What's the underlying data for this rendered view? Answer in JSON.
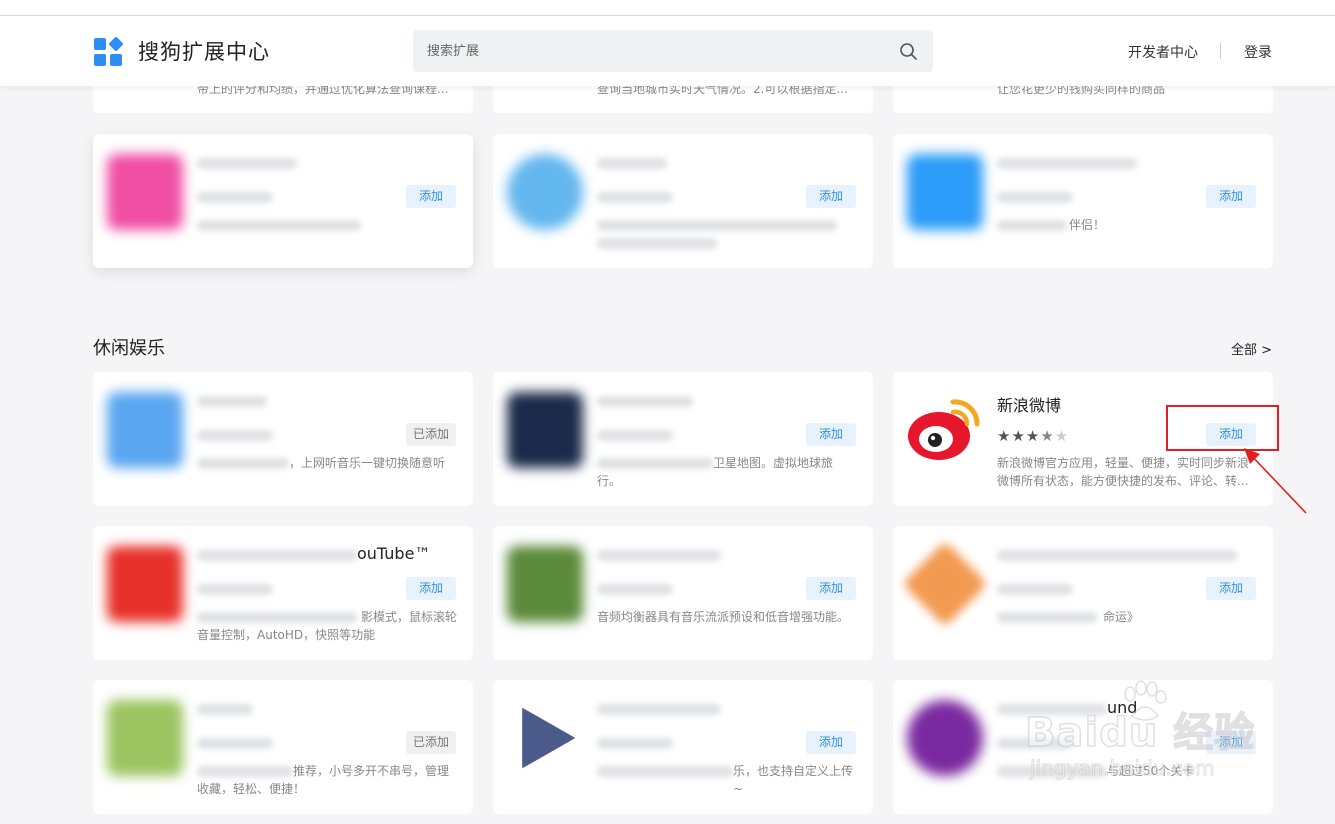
{
  "header": {
    "logo_text": "搜狗扩展中心",
    "search_placeholder": "搜索扩展",
    "developer_center": "开发者中心",
    "login": "登录"
  },
  "top_cut_row": [
    {
      "desc": "帝上的评分和均绩，并通过优化算法查询课程..."
    },
    {
      "desc": "查询当地城市实时天气情况。2.可以根据指定..."
    },
    {
      "desc": "让您花更少的钱购买同样的商品"
    }
  ],
  "row1": [
    {
      "button": "添加",
      "desc": "",
      "icon_color": "#f04fa4"
    },
    {
      "button": "添加",
      "desc": "",
      "icon_color": "#63b7ef"
    },
    {
      "button": "添加",
      "desc": "伴侣！",
      "icon_color": "#2b9cf8"
    }
  ],
  "section": {
    "title": "休闲娱乐",
    "see_all": "全部 >"
  },
  "row2": [
    {
      "button": "已添加",
      "desc": "，上网听音乐一键切换随意听",
      "icon_color": "#5aa6f0"
    },
    {
      "button": "添加",
      "desc": "卫星地图。虚拟地球旅行。",
      "icon_color": "#1b2a4a"
    },
    {
      "title": "新浪微博",
      "rating": "3.5",
      "button": "添加",
      "desc": "新浪微博官方应用，轻量、便捷，实时同步新浪微博所有状态，能方便快捷的发布、评论、转...",
      "icon_color": "#e6162d"
    }
  ],
  "row3": [
    {
      "title_suffix": "ouTube™",
      "button": "添加",
      "desc": "影模式，鼠标滚轮音量控制，AutoHD，快照等功能",
      "icon_color": "#e8302a"
    },
    {
      "button": "添加",
      "desc": "音频均衡器具有音乐流派预设和低音增强功能。",
      "icon_color": "#5a8a3a"
    },
    {
      "button": "添加",
      "desc": "命运》",
      "icon_color": "#f39a52"
    }
  ],
  "row4": [
    {
      "button": "已添加",
      "desc": "推荐，小号多开不串号，管理收藏，轻松、便捷！",
      "icon_color": "#9cc460"
    },
    {
      "button": "添加",
      "desc": "乐，也支持自定义上传~",
      "icon_color": "#4a5a8a"
    },
    {
      "title_suffix": "und",
      "button": "添加",
      "desc": "与超过50个关卡",
      "icon_color": "#7a2aa0"
    }
  ],
  "watermark": {
    "brand": "Baidu 经验",
    "url": "jingyan.baidu.com"
  }
}
